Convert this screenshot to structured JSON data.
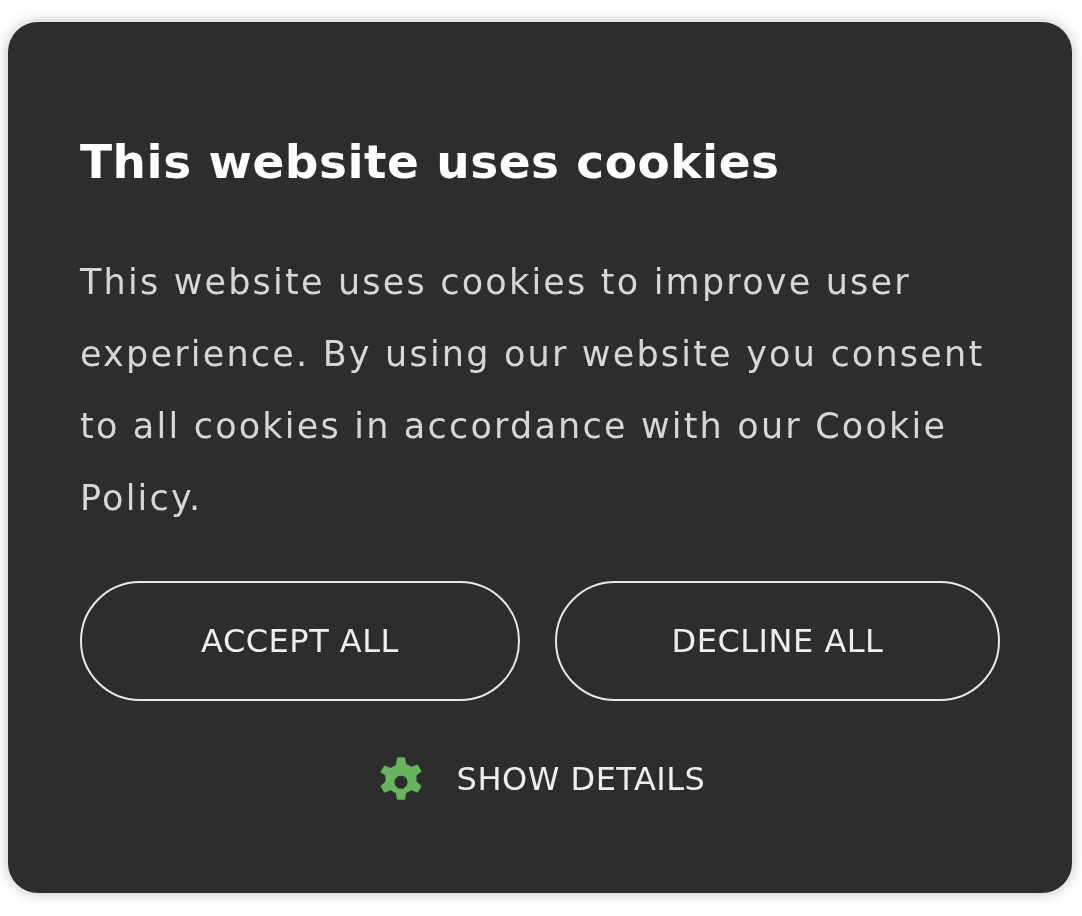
{
  "dialog": {
    "title": "This website uses cookies",
    "message": "This website uses cookies to improve user experience. By using our website you consent to all cookies in accordance with our Cookie Policy.",
    "buttons": [
      {
        "label": "ACCEPT ALL"
      },
      {
        "label": "DECLINE ALL"
      }
    ],
    "details_link": {
      "label": "SHOW DETAILS"
    }
  }
}
